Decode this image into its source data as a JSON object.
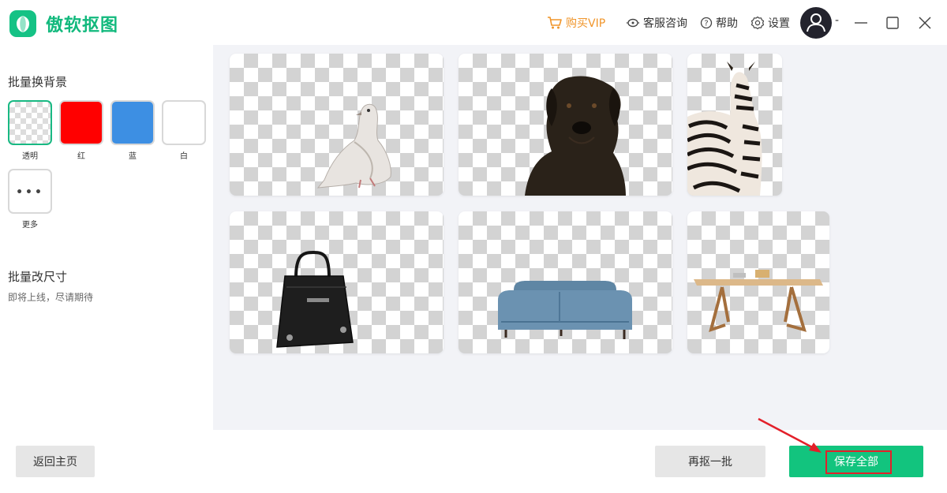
{
  "app": {
    "name": "傲软抠图"
  },
  "header": {
    "vip_label": "购买VIP",
    "service_label": "客服咨询",
    "help_label": "帮助",
    "settings_label": "设置",
    "user_name": "-"
  },
  "sidebar": {
    "bg_title": "批量换背景",
    "swatches": [
      {
        "label": "透明",
        "color": "transparent"
      },
      {
        "label": "红",
        "color": "#ff0000"
      },
      {
        "label": "蓝",
        "color": "#3d8fe3"
      },
      {
        "label": "白",
        "color": "#ffffff"
      }
    ],
    "more_label": "更多",
    "resize_title": "批量改尺寸",
    "resize_sub": "即将上线，尽请期待"
  },
  "images": [
    {
      "name": "pigeon"
    },
    {
      "name": "dog"
    },
    {
      "name": "zebra"
    },
    {
      "name": "handbag"
    },
    {
      "name": "sofa"
    },
    {
      "name": "table"
    }
  ],
  "footer": {
    "home_label": "返回主页",
    "again_label": "再抠一批",
    "save_all_label": "保存全部"
  },
  "colors": {
    "accent": "#12c47e",
    "vip": "#f0952a",
    "highlight": "#e3202a"
  }
}
